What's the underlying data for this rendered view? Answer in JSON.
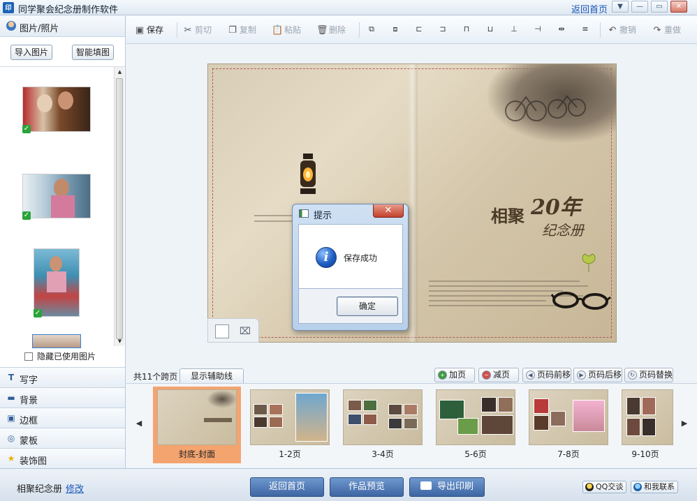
{
  "titlebar": {
    "app_icon_text": "印",
    "title": "同学聚会纪念册制作软件",
    "home_link": "返回首页",
    "buttons": [
      "▼",
      "—",
      "▭",
      "✕"
    ]
  },
  "left_panel": {
    "header": "图片/照片",
    "import_button": "导入图片",
    "smart_fill_button": "智能填图",
    "hide_used_label": "隐藏已使用图片",
    "tools": [
      {
        "label": "写字",
        "icon": "T"
      },
      {
        "label": "背景",
        "icon": "▬"
      },
      {
        "label": "边框",
        "icon": "▣"
      },
      {
        "label": "蒙板",
        "icon": "◎"
      },
      {
        "label": "装饰图",
        "icon": "★"
      }
    ]
  },
  "toolbar": {
    "save": "保存",
    "cut": "剪切",
    "copy": "复制",
    "paste": "粘贴",
    "delete": "删除",
    "undo": "撤销",
    "redo": "重做"
  },
  "cover": {
    "title_main": "相聚",
    "title_year": "20年",
    "title_album": "纪念册"
  },
  "dialog": {
    "title": "提示",
    "close": "✕",
    "message": "保存成功",
    "ok_button": "确定"
  },
  "pagebar": {
    "spread_count": "共11个跨页",
    "guide_button": "显示辅助线",
    "add_page": "加页",
    "remove_page": "减页",
    "page_forward": "页码前移",
    "page_back": "页码后移",
    "page_swap": "页码替换"
  },
  "thumbnails": [
    {
      "label": "封底-封面",
      "selected": true
    },
    {
      "label": "1-2页",
      "selected": false
    },
    {
      "label": "3-4页",
      "selected": false
    },
    {
      "label": "5-6页",
      "selected": false
    },
    {
      "label": "7-8页",
      "selected": false
    },
    {
      "label": "9-10页",
      "selected": false
    }
  ],
  "statusbar": {
    "album_name": "相聚纪念册",
    "edit_link": "修改",
    "home_button": "返回首页",
    "preview_button": "作品预览",
    "export_button": "导出印刷",
    "qq_chat": "QQ交谈",
    "contact": "和我联系"
  },
  "colors": {
    "accent_blue": "#3d66a3",
    "selected_thumb": "#f4a46f",
    "link": "#1a56b8"
  }
}
